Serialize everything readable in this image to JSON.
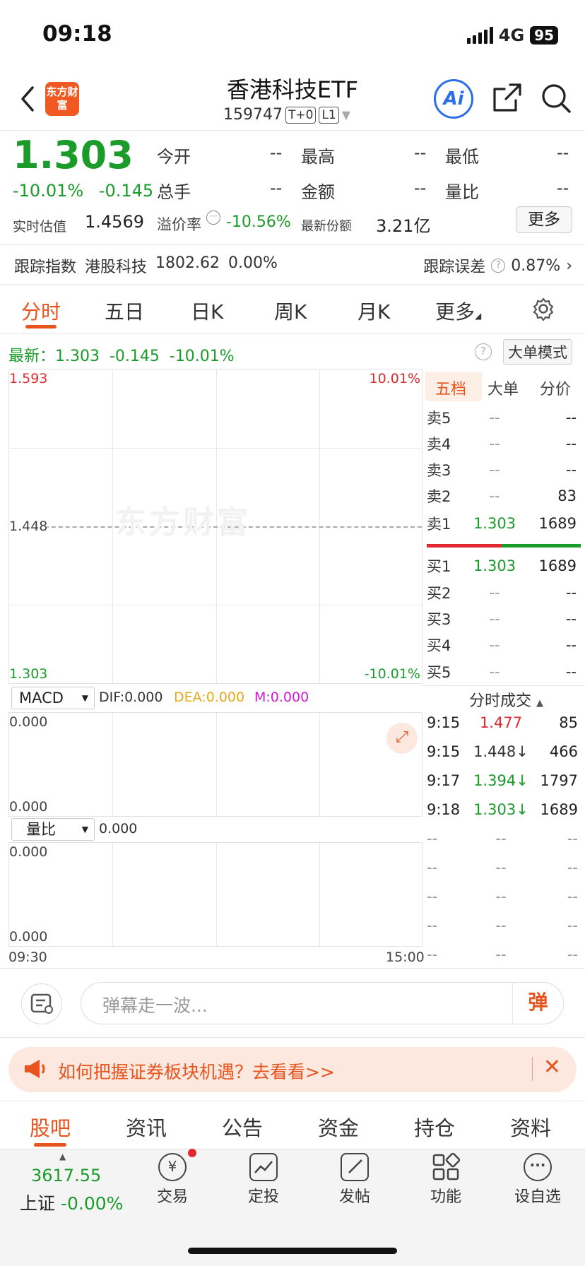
{
  "status_bar": {
    "time": "09:18",
    "network": "4G",
    "battery": "95"
  },
  "header": {
    "logo_text": "东方财富",
    "title": "香港科技ETF",
    "code": "159747",
    "tag1": "T+0",
    "tag2": "L1",
    "ai_label": "Ai"
  },
  "quote": {
    "price": "1.303",
    "pct_change": "-10.01%",
    "abs_change": "-0.145",
    "stats": [
      {
        "label": "今开",
        "value": "--"
      },
      {
        "label": "最高",
        "value": "--"
      },
      {
        "label": "最低",
        "value": "--"
      },
      {
        "label": "总手",
        "value": "--"
      },
      {
        "label": "金额",
        "value": "--"
      },
      {
        "label": "量比",
        "value": "--"
      }
    ],
    "est_label": "实时估值",
    "est_value": "1.4569",
    "premium_label": "溢价率",
    "premium_value": "-10.56%",
    "shares_label": "最新份额",
    "shares_value": "3.21亿",
    "more_button": "更多"
  },
  "tracking": {
    "index_label": "跟踪指数",
    "index_name": "港股科技",
    "index_value": "1802.62",
    "index_change": "0.00%",
    "error_label": "跟踪误差",
    "error_value": "0.87%"
  },
  "chart_tabs": [
    "分时",
    "五日",
    "日K",
    "周K",
    "月K",
    "更多"
  ],
  "latest": {
    "text": "最新：1.303  -0.145  -10.01%",
    "bigorder_button": "大单模式"
  },
  "chart": {
    "y_top": "1.593",
    "y_mid": "1.448",
    "y_bottom": "1.303",
    "pct_top": "10.01%",
    "pct_bottom": "-10.01%",
    "watermark": "东方财富",
    "time_start": "09:30",
    "time_end": "15:00"
  },
  "macd": {
    "selector": "MACD",
    "dif": "DIF:0.000",
    "dea": "DEA:0.000",
    "m": "M:0.000",
    "top": "0.000",
    "bottom": "0.000"
  },
  "volume_ratio": {
    "selector": "量比",
    "value": "0.000",
    "top": "0.000",
    "bottom": "0.000"
  },
  "orderbook": {
    "tabs": [
      "五档",
      "大单",
      "分价"
    ],
    "asks": [
      {
        "label": "卖5",
        "price": "--",
        "vol": "--"
      },
      {
        "label": "卖4",
        "price": "--",
        "vol": "--"
      },
      {
        "label": "卖3",
        "price": "--",
        "vol": "--"
      },
      {
        "label": "卖2",
        "price": "--",
        "vol": "83"
      },
      {
        "label": "卖1",
        "price": "1.303",
        "vol": "1689"
      }
    ],
    "bids": [
      {
        "label": "买1",
        "price": "1.303",
        "vol": "1689"
      },
      {
        "label": "买2",
        "price": "--",
        "vol": "--"
      },
      {
        "label": "买3",
        "price": "--",
        "vol": "--"
      },
      {
        "label": "买4",
        "price": "--",
        "vol": "--"
      },
      {
        "label": "买5",
        "price": "--",
        "vol": "--"
      }
    ],
    "ticks_title": "分时成交",
    "ticks": [
      {
        "time": "9:15",
        "price": "1.477",
        "vol": "85"
      },
      {
        "time": "9:15",
        "price": "1.448↓",
        "vol": "466"
      },
      {
        "time": "9:17",
        "price": "1.394↓",
        "vol": "1797"
      },
      {
        "time": "9:18",
        "price": "1.303↓",
        "vol": "1689"
      },
      {
        "time": "--",
        "price": "--",
        "vol": "--"
      },
      {
        "time": "--",
        "price": "--",
        "vol": "--"
      },
      {
        "time": "--",
        "price": "--",
        "vol": "--"
      },
      {
        "time": "--",
        "price": "--",
        "vol": "--"
      },
      {
        "time": "--",
        "price": "--",
        "vol": "--"
      }
    ]
  },
  "danmu": {
    "placeholder": "弹幕走一波...",
    "button": "弹"
  },
  "banner": {
    "text": "如何把握证券板块机遇？去看看>>"
  },
  "bottom_tabs": [
    "股吧",
    "资讯",
    "公告",
    "资金",
    "持仓",
    "资料"
  ],
  "bottom_nav": {
    "index_value": "3617.55",
    "index_name": "上证",
    "index_change": "-0.00%",
    "items": [
      "交易",
      "定投",
      "发帖",
      "功能",
      "设自选"
    ]
  },
  "colors": {
    "accent": "#e8541e",
    "up": "#e0282e",
    "down": "#1a9b2a",
    "link": "#2b6ee8"
  }
}
